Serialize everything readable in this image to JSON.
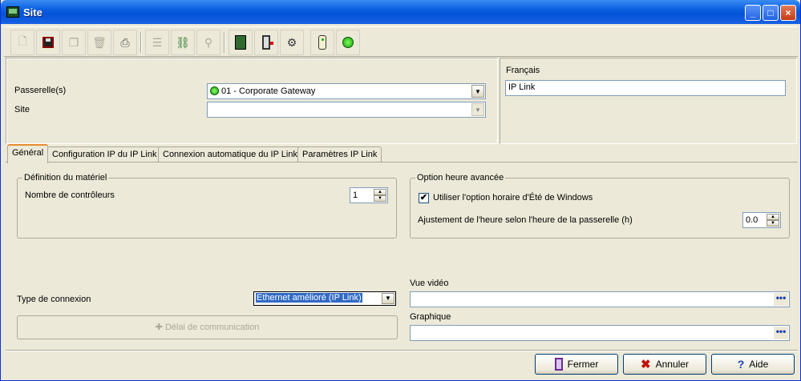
{
  "window": {
    "title": "Site"
  },
  "toolbar": {
    "icons": [
      "new-icon",
      "save-icon",
      "copy-icon",
      "delete-icon",
      "print-icon",
      "list-icon",
      "link-icon",
      "find-icon",
      "controller-icon",
      "door-icon",
      "relay-icon",
      "reader-icon",
      "status-icon"
    ]
  },
  "top": {
    "gateway_label": "Passerelle(s)",
    "gateway_value": "01 - Corporate Gateway",
    "site_label": "Site",
    "site_value": "",
    "language_label": "Français",
    "language_value": "IP Link"
  },
  "tabs": [
    {
      "label": "Général",
      "selected": true
    },
    {
      "label": "Configuration IP du IP Link",
      "selected": false
    },
    {
      "label": "Connexion automatique du IP Link",
      "selected": false
    },
    {
      "label": "Paramètres IP Link",
      "selected": false
    }
  ],
  "hardware": {
    "legend": "Définition du matériel",
    "controllers_label": "Nombre de contrôleurs",
    "controllers_value": "1"
  },
  "time_option": {
    "legend": "Option heure avancée",
    "dst_label": "Utiliser l'option horaire d'Été de Windows",
    "dst_checked": true,
    "adjust_label": "Ajustement de l'heure selon l'heure de la passerelle (h)",
    "adjust_value": "0.0"
  },
  "connection": {
    "type_label": "Type de connexion",
    "type_value": "Ethernet amélioré (IP Link)",
    "delay_button": "Délai de communication"
  },
  "video": {
    "label": "Vue vidéo",
    "value": ""
  },
  "graphic": {
    "label": "Graphique",
    "value": ""
  },
  "footer": {
    "close": "Fermer",
    "cancel": "Annuler",
    "help": "Aide"
  }
}
